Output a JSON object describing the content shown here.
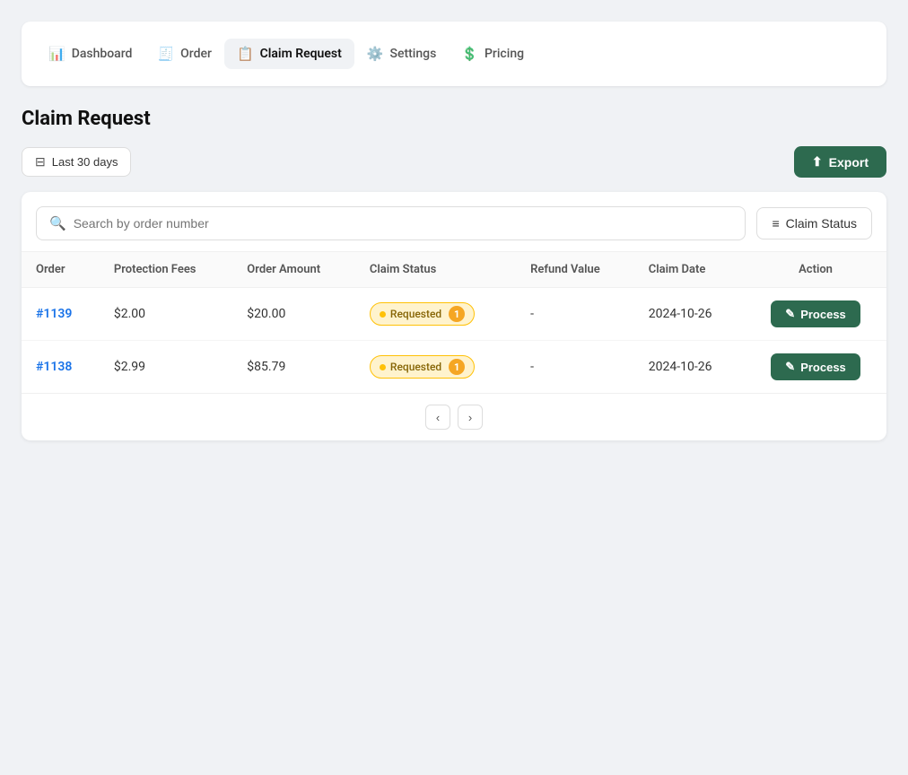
{
  "nav": {
    "items": [
      {
        "id": "dashboard",
        "label": "Dashboard",
        "icon": "📊",
        "active": false
      },
      {
        "id": "order",
        "label": "Order",
        "icon": "🧾",
        "active": false
      },
      {
        "id": "claim-request",
        "label": "Claim Request",
        "icon": "📋",
        "active": true
      },
      {
        "id": "settings",
        "label": "Settings",
        "icon": "⚙️",
        "active": false
      },
      {
        "id": "pricing",
        "label": "Pricing",
        "icon": "💲",
        "active": false
      }
    ]
  },
  "page": {
    "title": "Claim Request"
  },
  "toolbar": {
    "date_filter_label": "Last 30 days",
    "export_label": "Export"
  },
  "search": {
    "placeholder": "Search by order number"
  },
  "filter_btn": {
    "label": "Claim Status"
  },
  "table": {
    "columns": [
      "Order",
      "Protection Fees",
      "Order Amount",
      "Claim Status",
      "Refund Value",
      "Claim Date",
      "Action"
    ],
    "rows": [
      {
        "order": "#1139",
        "protection_fees": "$2.00",
        "order_amount": "$20.00",
        "claim_status": "Requested",
        "claim_status_count": "1",
        "refund_value": "-",
        "claim_date": "2024-10-26",
        "action": "Process"
      },
      {
        "order": "#1138",
        "protection_fees": "$2.99",
        "order_amount": "$85.79",
        "claim_status": "Requested",
        "claim_status_count": "1",
        "refund_value": "-",
        "claim_date": "2024-10-26",
        "action": "Process"
      }
    ]
  },
  "pagination": {
    "prev_icon": "‹",
    "next_icon": "›"
  }
}
